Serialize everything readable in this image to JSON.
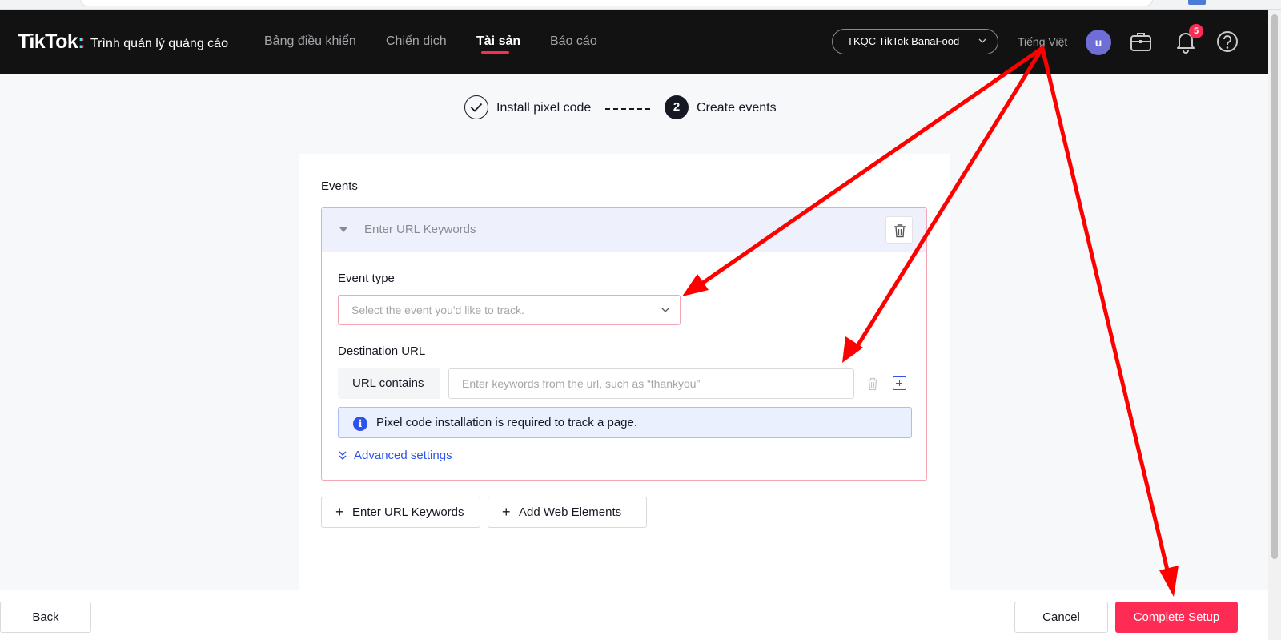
{
  "header": {
    "logo": "TikTok",
    "logo_colon": ":",
    "subtitle": "Trình quản lý quảng cáo",
    "nav": [
      {
        "label": "Bảng điều khiển"
      },
      {
        "label": "Chiến dịch"
      },
      {
        "label": "Tài sản",
        "active": true
      },
      {
        "label": "Báo cáo"
      }
    ],
    "account": "TKQC TikTok BanaFood",
    "language": "Tiếng Việt",
    "avatar_letter": "u",
    "notification_count": "5"
  },
  "steps": [
    {
      "label": "Install pixel code",
      "state": "done"
    },
    {
      "number": "2",
      "label": "Create events",
      "state": "current"
    }
  ],
  "events": {
    "title": "Events",
    "collapsed_header": "Enter URL Keywords",
    "event_type_label": "Event type",
    "event_type_placeholder": "Select the event you'd like to track.",
    "destination_label": "Destination URL",
    "url_rule": "URL contains",
    "url_placeholder": "Enter keywords from the url, such as “thankyou”",
    "info_text": "Pixel code installation is required to track a page.",
    "advanced_label": "Advanced settings"
  },
  "add_buttons": {
    "url_keywords": "Enter URL Keywords",
    "web_elements": "Add Web Elements"
  },
  "footer": {
    "back": "Back",
    "cancel": "Cancel",
    "complete": "Complete Setup"
  },
  "colors": {
    "brand": "#fe2c55",
    "topbar": "#121212",
    "link": "#2f54eb",
    "annotation": "#ff0000"
  }
}
